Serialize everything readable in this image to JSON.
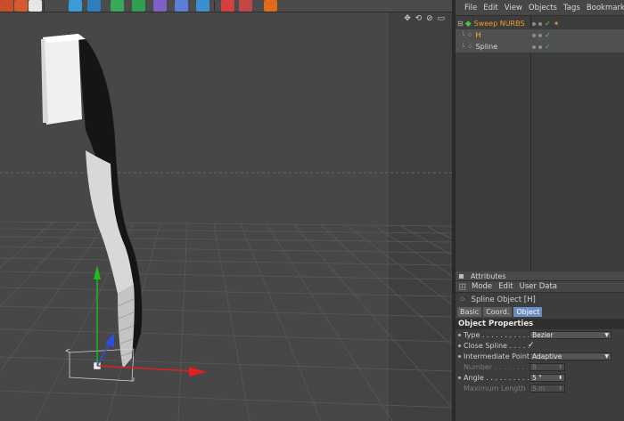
{
  "object_manager": {
    "menu": [
      "File",
      "Edit",
      "View",
      "Objects",
      "Tags",
      "Bookmarks"
    ],
    "objects": [
      {
        "name": "Sweep NURBS",
        "color": "#f09a2a",
        "selected": false
      },
      {
        "name": "H",
        "color": "#f0c040",
        "selected": true
      },
      {
        "name": "Spline",
        "color": "#d6d6d6",
        "selected": true
      }
    ],
    "check_color": "#43d843"
  },
  "attributes": {
    "panel_title": "Attributes",
    "menu": [
      "Mode",
      "Edit",
      "User Data"
    ],
    "object_title": "Spline Object [H]",
    "tabs": [
      {
        "label": "Basic",
        "active": false
      },
      {
        "label": "Coord.",
        "active": false
      },
      {
        "label": "Object",
        "active": true
      }
    ],
    "section": "Object Properties",
    "properties": {
      "type": {
        "label": "Type . . . . . . . . . . . . .",
        "value": "Bezier"
      },
      "close_spline": {
        "label": "Close Spline . . . . .",
        "value": "✓"
      },
      "intermediate": {
        "label": "Intermediate Points",
        "value": "Adaptive"
      },
      "number": {
        "label": "Number . . . . . . . . . .",
        "value": "8"
      },
      "angle": {
        "label": "Angle . . . . . . . . . . . .",
        "value": "5 °"
      },
      "max_length": {
        "label": "Maximum Length",
        "value": "5 m"
      }
    }
  },
  "viewport": {
    "nav_icons": "✥ ⟲ ⊘ ▭",
    "background": "#474747",
    "axis_colors": {
      "x": "#e02020",
      "y": "#18c018",
      "z": "#2850e0"
    }
  }
}
